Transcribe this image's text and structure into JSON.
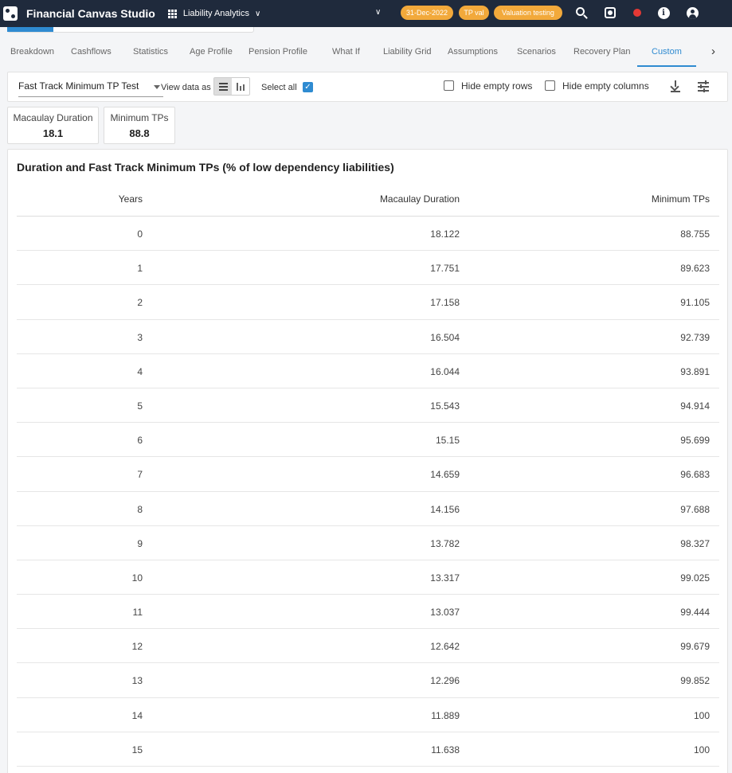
{
  "header": {
    "app_title": "Financial Canvas Studio",
    "module": "Liability Analytics",
    "date_badge": "31-Dec-2022",
    "tp_badge": "TP val",
    "scenario_badge": "Valuation testing"
  },
  "tabs": [
    {
      "label": "Breakdown"
    },
    {
      "label": "Cashflows"
    },
    {
      "label": "Statistics"
    },
    {
      "label": "Age Profile"
    },
    {
      "label": "Pension Profile"
    },
    {
      "label": "What If"
    },
    {
      "label": "Liability Grid"
    },
    {
      "label": "Assumptions"
    },
    {
      "label": "Scenarios"
    },
    {
      "label": "Recovery Plan"
    },
    {
      "label": "Custom",
      "active": true
    }
  ],
  "controls": {
    "report_select": "Fast Track Minimum TP Test",
    "view_label": "View data as",
    "select_all_label": "Select all",
    "select_all_checked": true,
    "hide_empty_rows_label": "Hide empty rows",
    "hide_empty_columns_label": "Hide empty columns"
  },
  "metrics": [
    {
      "label": "Macaulay Duration",
      "value": "18.1"
    },
    {
      "label": "Minimum TPs",
      "value": "88.8"
    }
  ],
  "table": {
    "title": "Duration and Fast Track Minimum TPs (% of low dependency liabilities)",
    "columns": [
      "Years",
      "Macaulay Duration",
      "Minimum TPs"
    ],
    "rows": [
      [
        "0",
        "18.122",
        "88.755"
      ],
      [
        "1",
        "17.751",
        "89.623"
      ],
      [
        "2",
        "17.158",
        "91.105"
      ],
      [
        "3",
        "16.504",
        "92.739"
      ],
      [
        "4",
        "16.044",
        "93.891"
      ],
      [
        "5",
        "15.543",
        "94.914"
      ],
      [
        "6",
        "15.15",
        "95.699"
      ],
      [
        "7",
        "14.659",
        "96.683"
      ],
      [
        "8",
        "14.156",
        "97.688"
      ],
      [
        "9",
        "13.782",
        "98.327"
      ],
      [
        "10",
        "13.317",
        "99.025"
      ],
      [
        "11",
        "13.037",
        "99.444"
      ],
      [
        "12",
        "12.642",
        "99.679"
      ],
      [
        "13",
        "12.296",
        "99.852"
      ],
      [
        "14",
        "11.889",
        "100"
      ],
      [
        "15",
        "11.638",
        "100"
      ]
    ]
  },
  "colors": {
    "topbar": "#1f2a3c",
    "accent": "#2f8bd1",
    "badge": "#f2a93b",
    "record": "#e53935"
  }
}
